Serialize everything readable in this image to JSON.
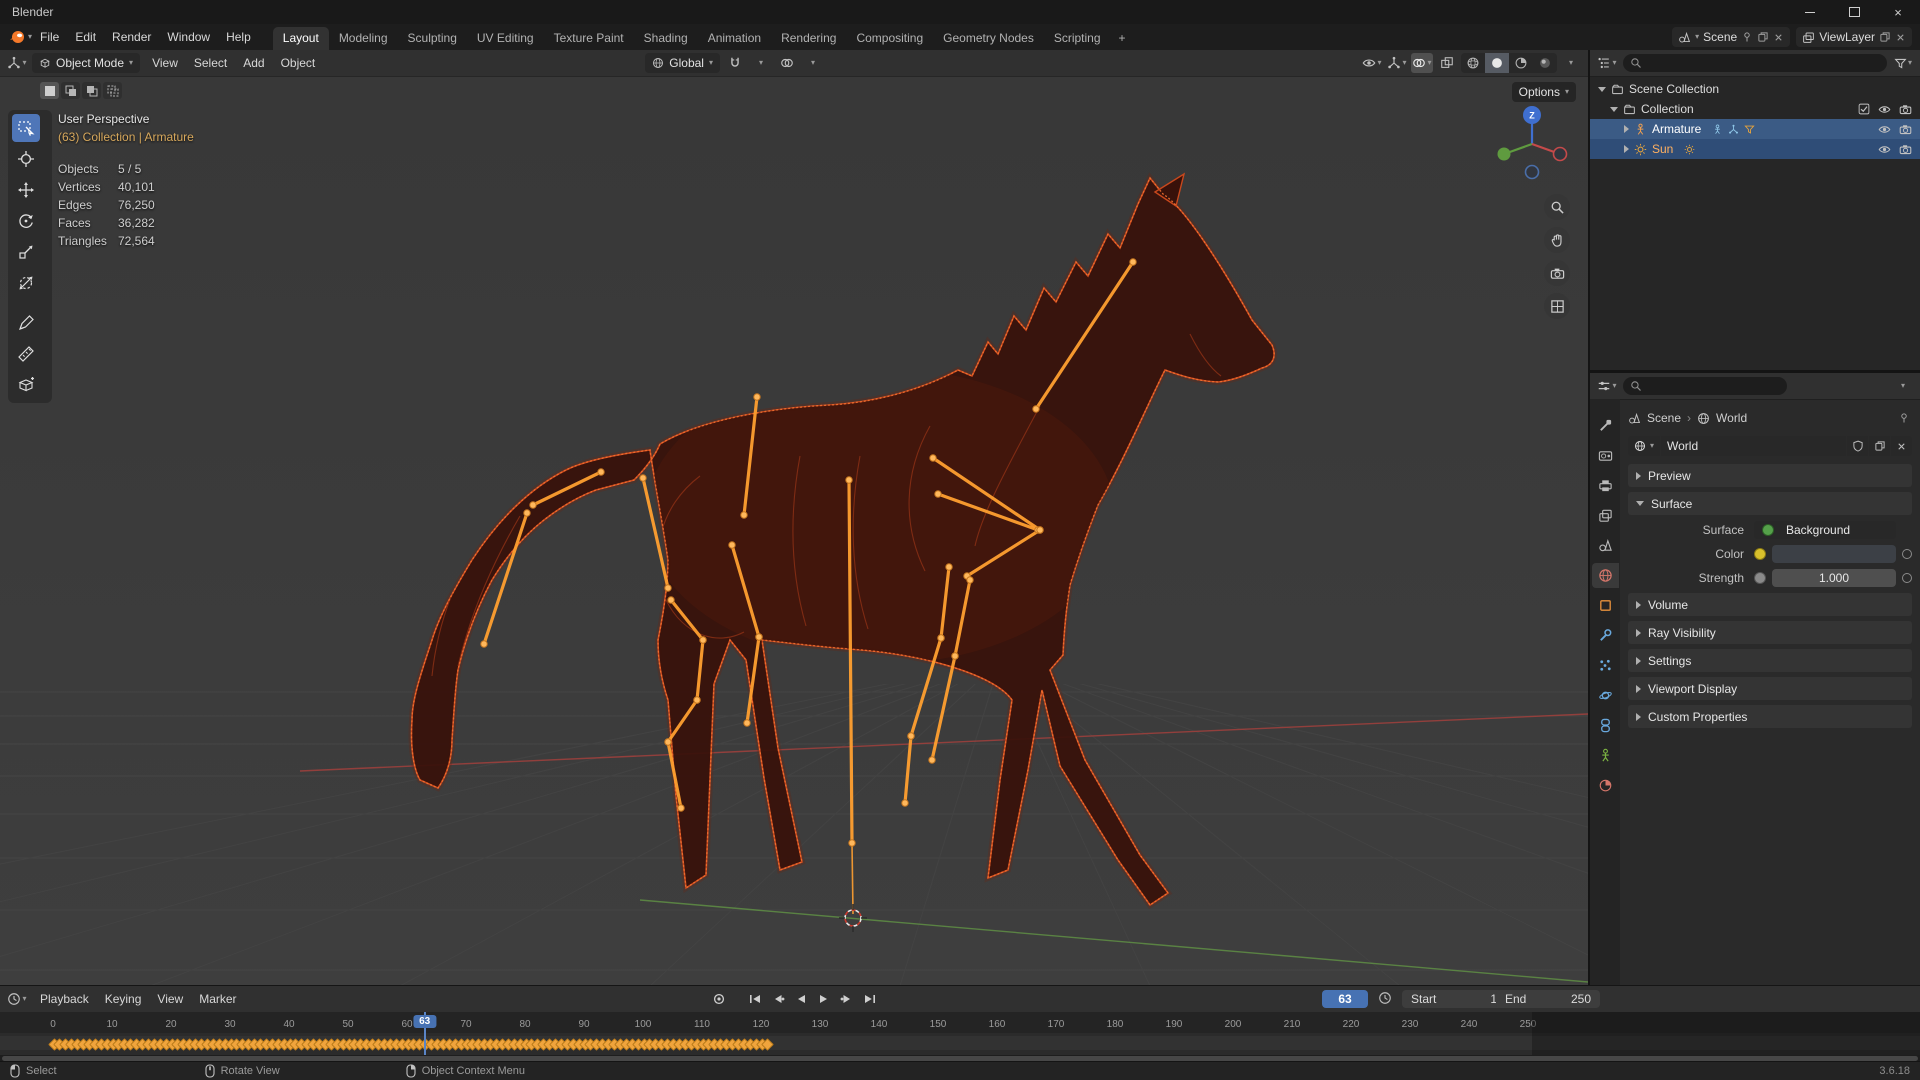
{
  "titlebar": {
    "title": "Blender"
  },
  "menubar": {
    "menus": [
      "File",
      "Edit",
      "Render",
      "Window",
      "Help"
    ],
    "workspaces": [
      "Layout",
      "Modeling",
      "Sculpting",
      "UV Editing",
      "Texture Paint",
      "Shading",
      "Animation",
      "Rendering",
      "Compositing",
      "Geometry Nodes",
      "Scripting"
    ],
    "active_workspace": "Layout",
    "new_workspace_label": "+",
    "scene": "Scene",
    "view_layer": "ViewLayer"
  },
  "viewport_header": {
    "mode": "Object Mode",
    "menus": [
      "View",
      "Select",
      "Add",
      "Object"
    ],
    "orientation": "Global"
  },
  "viewport": {
    "options_label": "Options",
    "overlay": {
      "view_label": "User Perspective",
      "context_label": "(63) Collection | Armature",
      "stats": [
        {
          "label": "Objects",
          "value": "5 / 5"
        },
        {
          "label": "Vertices",
          "value": "40,101"
        },
        {
          "label": "Edges",
          "value": "76,250"
        },
        {
          "label": "Faces",
          "value": "36,282"
        },
        {
          "label": "Triangles",
          "value": "72,564"
        }
      ]
    },
    "gizmo": {
      "z_label": "Z"
    }
  },
  "outliner": {
    "scene_collection": "Scene Collection",
    "collection": "Collection",
    "armature": "Armature",
    "sun": "Sun"
  },
  "properties": {
    "breadcrumb": {
      "scene": "Scene",
      "world": "World"
    },
    "world_name": "World",
    "panels": {
      "preview": "Preview",
      "surface": "Surface",
      "volume": "Volume",
      "ray_visibility": "Ray Visibility",
      "settings": "Settings",
      "viewport_display": "Viewport Display",
      "custom_properties": "Custom Properties"
    },
    "surface": {
      "surface_label": "Surface",
      "surface_value": "Background",
      "color_label": "Color",
      "strength_label": "Strength",
      "strength_value": "1.000"
    }
  },
  "timeline": {
    "menus": [
      "Playback",
      "Keying",
      "View",
      "Marker"
    ],
    "current_frame": 63,
    "start_label": "Start",
    "start_value": "1",
    "end_label": "End",
    "end_value": "250",
    "ticks": [
      0,
      10,
      20,
      30,
      40,
      50,
      60,
      70,
      80,
      90,
      100,
      110,
      120,
      130,
      140,
      150,
      160,
      170,
      180,
      190,
      200,
      210,
      220,
      230,
      240,
      250
    ],
    "keyframes": {
      "first_frame": 0,
      "last_frame": 121
    }
  },
  "statusbar": {
    "select": "Select",
    "rotate": "Rotate View",
    "context_menu": "Object Context Menu",
    "version": "3.6.18"
  },
  "colors": {
    "accent": "#4772b3",
    "keyframe": "#f0a43c",
    "bone": "#ffa030",
    "selection_text": "#ffb060",
    "horse_wire": "#c8481d",
    "axis_x": "#a2403c",
    "axis_y": "#5f8f45"
  }
}
